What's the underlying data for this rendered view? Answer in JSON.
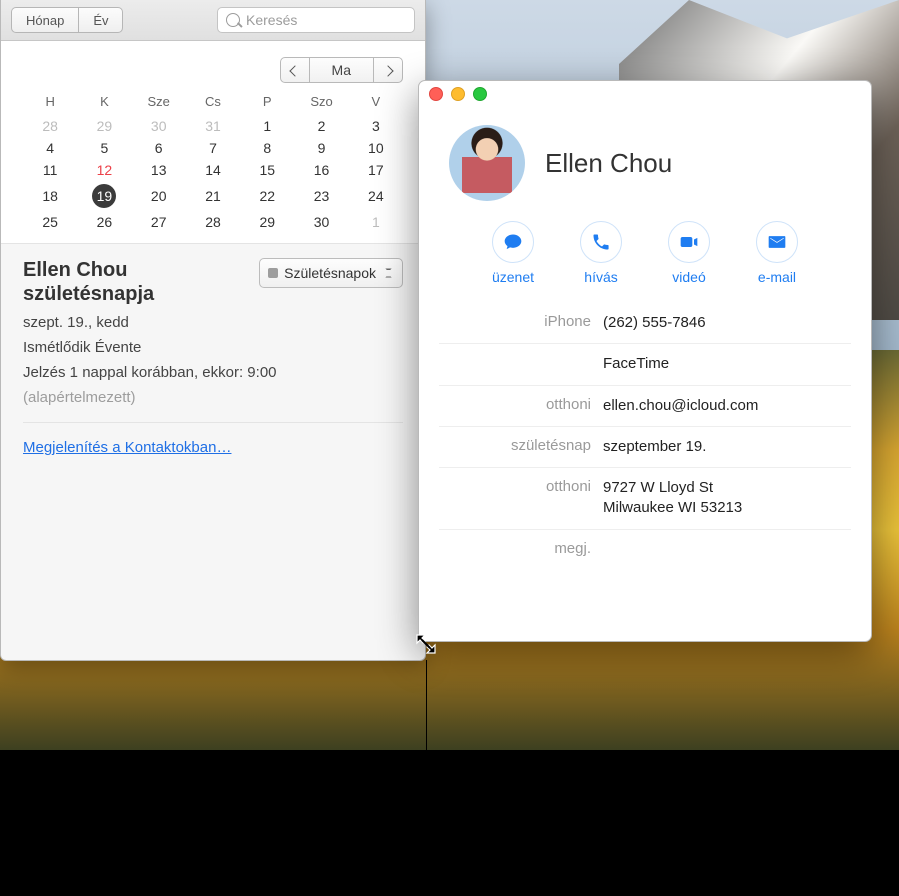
{
  "calendar": {
    "toolbar": {
      "month": "Hónap",
      "year": "Év",
      "search_placeholder": "Keresés"
    },
    "nav": {
      "today": "Ma"
    },
    "day_headers": [
      "H",
      "K",
      "Sze",
      "Cs",
      "P",
      "Szo",
      "V"
    ],
    "weeks": [
      [
        {
          "d": "28",
          "o": true
        },
        {
          "d": "29",
          "o": true
        },
        {
          "d": "30",
          "o": true
        },
        {
          "d": "31",
          "o": true
        },
        {
          "d": "1"
        },
        {
          "d": "2"
        },
        {
          "d": "3"
        }
      ],
      [
        {
          "d": "4"
        },
        {
          "d": "5"
        },
        {
          "d": "6"
        },
        {
          "d": "7"
        },
        {
          "d": "8"
        },
        {
          "d": "9"
        },
        {
          "d": "10"
        }
      ],
      [
        {
          "d": "11"
        },
        {
          "d": "12",
          "red": true
        },
        {
          "d": "13"
        },
        {
          "d": "14"
        },
        {
          "d": "15"
        },
        {
          "d": "16"
        },
        {
          "d": "17"
        }
      ],
      [
        {
          "d": "18"
        },
        {
          "d": "19",
          "sel": true
        },
        {
          "d": "20"
        },
        {
          "d": "21"
        },
        {
          "d": "22"
        },
        {
          "d": "23"
        },
        {
          "d": "24"
        }
      ],
      [
        {
          "d": "25"
        },
        {
          "d": "26"
        },
        {
          "d": "27"
        },
        {
          "d": "28"
        },
        {
          "d": "29"
        },
        {
          "d": "30"
        },
        {
          "d": "1",
          "o": true
        }
      ]
    ],
    "event": {
      "title": "Ellen Chou születésnapja",
      "calendar_select": "Születésnapok",
      "date_line": "szept. 19., kedd",
      "repeat_line": "Ismétlődik Évente",
      "alert_line": "Jelzés 1 nappal korábban, ekkor: 9:00",
      "alert_sub": "(alapértelmezett)",
      "link": "Megjelenítés a Kontaktokban…"
    }
  },
  "contact": {
    "name": "Ellen Chou",
    "actions": {
      "message": "üzenet",
      "call": "hívás",
      "video": "videó",
      "email": "e-mail"
    },
    "rows": [
      {
        "label": "iPhone",
        "value": "(262) 555-7846"
      },
      {
        "label": "",
        "value": "FaceTime"
      },
      {
        "label": "otthoni",
        "value": "ellen.chou@icloud.com"
      },
      {
        "label": "születésnap",
        "value": "szeptember 19."
      },
      {
        "label": "otthoni",
        "value": "9727 W Lloyd St\nMilwaukee WI 53213"
      },
      {
        "label": "megj.",
        "value": ""
      }
    ]
  }
}
